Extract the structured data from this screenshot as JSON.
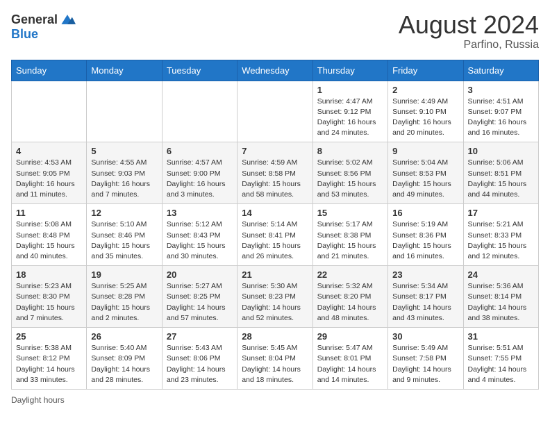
{
  "header": {
    "logo_general": "General",
    "logo_blue": "Blue",
    "main_title": "August 2024",
    "subtitle": "Parfino, Russia"
  },
  "calendar": {
    "days_of_week": [
      "Sunday",
      "Monday",
      "Tuesday",
      "Wednesday",
      "Thursday",
      "Friday",
      "Saturday"
    ],
    "weeks": [
      [
        {
          "day": "",
          "info": ""
        },
        {
          "day": "",
          "info": ""
        },
        {
          "day": "",
          "info": ""
        },
        {
          "day": "",
          "info": ""
        },
        {
          "day": "1",
          "info": "Sunrise: 4:47 AM\nSunset: 9:12 PM\nDaylight: 16 hours and 24 minutes."
        },
        {
          "day": "2",
          "info": "Sunrise: 4:49 AM\nSunset: 9:10 PM\nDaylight: 16 hours and 20 minutes."
        },
        {
          "day": "3",
          "info": "Sunrise: 4:51 AM\nSunset: 9:07 PM\nDaylight: 16 hours and 16 minutes."
        }
      ],
      [
        {
          "day": "4",
          "info": "Sunrise: 4:53 AM\nSunset: 9:05 PM\nDaylight: 16 hours and 11 minutes."
        },
        {
          "day": "5",
          "info": "Sunrise: 4:55 AM\nSunset: 9:03 PM\nDaylight: 16 hours and 7 minutes."
        },
        {
          "day": "6",
          "info": "Sunrise: 4:57 AM\nSunset: 9:00 PM\nDaylight: 16 hours and 3 minutes."
        },
        {
          "day": "7",
          "info": "Sunrise: 4:59 AM\nSunset: 8:58 PM\nDaylight: 15 hours and 58 minutes."
        },
        {
          "day": "8",
          "info": "Sunrise: 5:02 AM\nSunset: 8:56 PM\nDaylight: 15 hours and 53 minutes."
        },
        {
          "day": "9",
          "info": "Sunrise: 5:04 AM\nSunset: 8:53 PM\nDaylight: 15 hours and 49 minutes."
        },
        {
          "day": "10",
          "info": "Sunrise: 5:06 AM\nSunset: 8:51 PM\nDaylight: 15 hours and 44 minutes."
        }
      ],
      [
        {
          "day": "11",
          "info": "Sunrise: 5:08 AM\nSunset: 8:48 PM\nDaylight: 15 hours and 40 minutes."
        },
        {
          "day": "12",
          "info": "Sunrise: 5:10 AM\nSunset: 8:46 PM\nDaylight: 15 hours and 35 minutes."
        },
        {
          "day": "13",
          "info": "Sunrise: 5:12 AM\nSunset: 8:43 PM\nDaylight: 15 hours and 30 minutes."
        },
        {
          "day": "14",
          "info": "Sunrise: 5:14 AM\nSunset: 8:41 PM\nDaylight: 15 hours and 26 minutes."
        },
        {
          "day": "15",
          "info": "Sunrise: 5:17 AM\nSunset: 8:38 PM\nDaylight: 15 hours and 21 minutes."
        },
        {
          "day": "16",
          "info": "Sunrise: 5:19 AM\nSunset: 8:36 PM\nDaylight: 15 hours and 16 minutes."
        },
        {
          "day": "17",
          "info": "Sunrise: 5:21 AM\nSunset: 8:33 PM\nDaylight: 15 hours and 12 minutes."
        }
      ],
      [
        {
          "day": "18",
          "info": "Sunrise: 5:23 AM\nSunset: 8:30 PM\nDaylight: 15 hours and 7 minutes."
        },
        {
          "day": "19",
          "info": "Sunrise: 5:25 AM\nSunset: 8:28 PM\nDaylight: 15 hours and 2 minutes."
        },
        {
          "day": "20",
          "info": "Sunrise: 5:27 AM\nSunset: 8:25 PM\nDaylight: 14 hours and 57 minutes."
        },
        {
          "day": "21",
          "info": "Sunrise: 5:30 AM\nSunset: 8:23 PM\nDaylight: 14 hours and 52 minutes."
        },
        {
          "day": "22",
          "info": "Sunrise: 5:32 AM\nSunset: 8:20 PM\nDaylight: 14 hours and 48 minutes."
        },
        {
          "day": "23",
          "info": "Sunrise: 5:34 AM\nSunset: 8:17 PM\nDaylight: 14 hours and 43 minutes."
        },
        {
          "day": "24",
          "info": "Sunrise: 5:36 AM\nSunset: 8:14 PM\nDaylight: 14 hours and 38 minutes."
        }
      ],
      [
        {
          "day": "25",
          "info": "Sunrise: 5:38 AM\nSunset: 8:12 PM\nDaylight: 14 hours and 33 minutes."
        },
        {
          "day": "26",
          "info": "Sunrise: 5:40 AM\nSunset: 8:09 PM\nDaylight: 14 hours and 28 minutes."
        },
        {
          "day": "27",
          "info": "Sunrise: 5:43 AM\nSunset: 8:06 PM\nDaylight: 14 hours and 23 minutes."
        },
        {
          "day": "28",
          "info": "Sunrise: 5:45 AM\nSunset: 8:04 PM\nDaylight: 14 hours and 18 minutes."
        },
        {
          "day": "29",
          "info": "Sunrise: 5:47 AM\nSunset: 8:01 PM\nDaylight: 14 hours and 14 minutes."
        },
        {
          "day": "30",
          "info": "Sunrise: 5:49 AM\nSunset: 7:58 PM\nDaylight: 14 hours and 9 minutes."
        },
        {
          "day": "31",
          "info": "Sunrise: 5:51 AM\nSunset: 7:55 PM\nDaylight: 14 hours and 4 minutes."
        }
      ]
    ]
  },
  "footer": {
    "note": "Daylight hours"
  }
}
